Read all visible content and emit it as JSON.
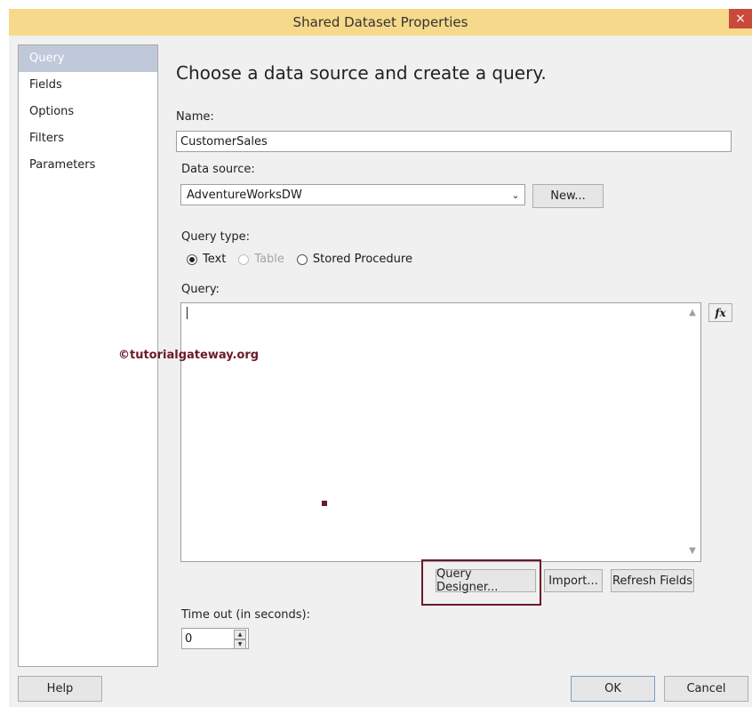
{
  "window": {
    "title": "Shared Dataset Properties",
    "close_label": "×"
  },
  "nav": {
    "items": [
      {
        "label": "Query",
        "selected": true
      },
      {
        "label": "Fields",
        "selected": false
      },
      {
        "label": "Options",
        "selected": false
      },
      {
        "label": "Filters",
        "selected": false
      },
      {
        "label": "Parameters",
        "selected": false
      }
    ]
  },
  "main": {
    "heading": "Choose a data source and create a query.",
    "name_label": "Name:",
    "name_value": "CustomerSales",
    "datasource_label": "Data source:",
    "datasource_value": "AdventureWorksDW",
    "new_button": "New...",
    "query_type_label": "Query type:",
    "query_types": [
      {
        "label": "Text",
        "checked": true,
        "disabled": false
      },
      {
        "label": "Table",
        "checked": false,
        "disabled": true
      },
      {
        "label": "Stored Procedure",
        "checked": false,
        "disabled": false
      }
    ],
    "query_label": "Query:",
    "query_value": "",
    "fx_label": "fx",
    "query_designer_button": "Query Designer...",
    "import_button": "Import...",
    "refresh_fields_button": "Refresh Fields",
    "timeout_label": "Time out (in seconds):",
    "timeout_value": "0"
  },
  "watermark": "©tutorialgateway.org",
  "footer": {
    "help_button": "Help",
    "ok_button": "OK",
    "cancel_button": "Cancel"
  },
  "colors": {
    "titlebar": "#f6d98a",
    "selected_nav": "#bfc9d9",
    "highlight": "#6b1a2a",
    "close": "#c94a3b"
  }
}
